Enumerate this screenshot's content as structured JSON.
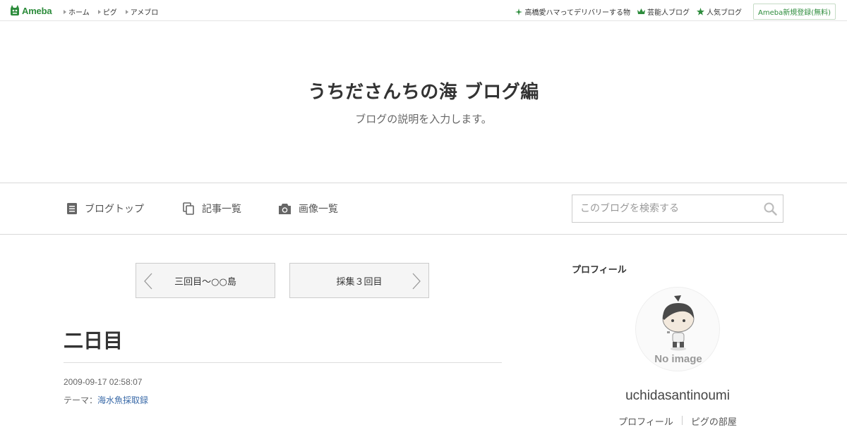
{
  "topbar": {
    "logo_text": "Ameba",
    "nav": [
      "ホーム",
      "ピグ",
      "アメブロ"
    ],
    "right_links": [
      {
        "label": "高橋愛ハマってデリバリーする物",
        "icon": "sparkle-icon"
      },
      {
        "label": "芸能人ブログ",
        "icon": "crown-icon"
      },
      {
        "label": "人気ブログ",
        "icon": "star-icon"
      }
    ],
    "register_label": "Ameba新規登録(無料)"
  },
  "header": {
    "title": "うちださんちの海 ブログ編",
    "description": "ブログの説明を入力します。"
  },
  "nav": {
    "items": [
      {
        "label": "ブログトップ",
        "icon": "document-icon"
      },
      {
        "label": "記事一覧",
        "icon": "copy-icon"
      },
      {
        "label": "画像一覧",
        "icon": "camera-icon"
      }
    ],
    "search_placeholder": "このブログを検索する"
  },
  "pager": {
    "prev": "三回目～○○島",
    "next": "採集３回目"
  },
  "entry": {
    "title": "二日目",
    "date": "2009-09-17 02:58:07",
    "theme_prefix": "テーマ：",
    "theme": "海水魚採取録"
  },
  "sidebar": {
    "heading": "プロフィール",
    "avatar_text": "No image",
    "username": "uchidasantinoumi",
    "links": [
      "プロフィール",
      "ピグの部屋"
    ]
  },
  "colors": {
    "brand": "#2d8c3c",
    "link": "#3a6aa8"
  }
}
